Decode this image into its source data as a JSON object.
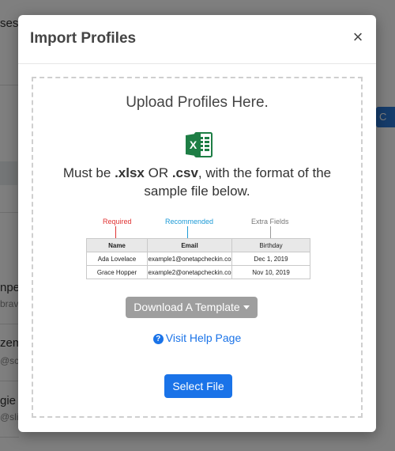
{
  "background": {
    "fragments": [
      "ses",
      "npe",
      "brav",
      "zem",
      "@sci",
      "gie",
      "@slic"
    ],
    "button_glyph": "C"
  },
  "modal": {
    "title": "Import Profiles",
    "close_glyph": "×",
    "upload_heading": "Upload Profiles Here.",
    "format_prefix": "Must be ",
    "format_ext1": ".xlsx",
    "format_or": " OR ",
    "format_ext2": ".csv",
    "format_suffix": ", with the format of the sample file below.",
    "sample": {
      "labels": {
        "required": "Required",
        "recommended": "Recommended",
        "extra": "Extra Fields"
      },
      "headers": [
        "Name",
        "Email",
        "Birthday"
      ],
      "rows": [
        [
          "Ada Lovelace",
          "example1@onetapcheckin.co",
          "Dec 1, 2019"
        ],
        [
          "Grace Hopper",
          "example2@onetapcheckin.co",
          "Nov 10, 2019"
        ]
      ]
    },
    "download_label": "Download A Template",
    "help_label": "Visit Help Page",
    "help_icon_glyph": "?",
    "select_label": "Select File"
  },
  "colors": {
    "primary": "#1a73e8",
    "required": "#e03131",
    "recommended": "#1c9ad6",
    "excel": "#1e7e45"
  },
  "icons": [
    "excel-icon",
    "question-circle-icon",
    "close-icon",
    "caret-down-icon"
  ]
}
